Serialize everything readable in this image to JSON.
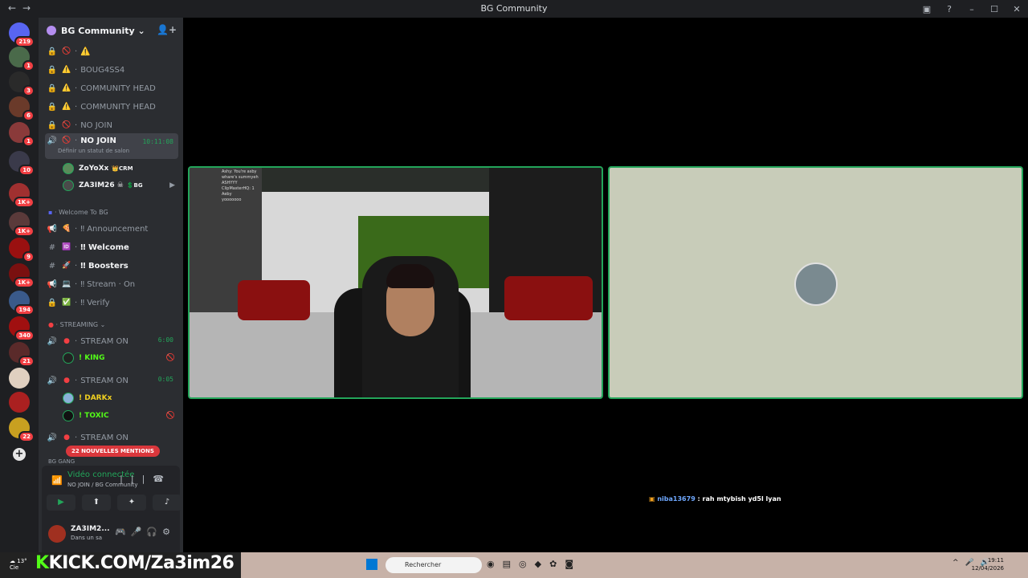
{
  "window": {
    "title": "BG Community"
  },
  "guild": {
    "name": "BG Community"
  },
  "servers": [
    {
      "badge": "219",
      "color": "#5865f2"
    },
    {
      "badge": "1",
      "color": "#4a6a4a"
    },
    {
      "badge": "3",
      "color": "#2a2a2a"
    },
    {
      "badge": "6",
      "color": "#6a3a2a"
    },
    {
      "badge": "1",
      "color": "#8a3a3a"
    },
    {
      "badge": "10",
      "color": "#3a3a4a"
    },
    {
      "badge": "1K+",
      "color": "#a03030"
    },
    {
      "badge": "1K+",
      "color": "#5a3a3a"
    },
    {
      "badge": "9",
      "color": "#9a1010"
    },
    {
      "badge": "1K+",
      "color": "#7a1010"
    },
    {
      "badge": "194",
      "color": "#3a5a8a"
    },
    {
      "badge": "340",
      "color": "#a01010"
    },
    {
      "badge": "21",
      "color": "#5a2a2a"
    },
    {
      "badge": "",
      "color": "#e0d0c0"
    },
    {
      "badge": "",
      "color": "#aa2020"
    },
    {
      "badge": "22",
      "color": "#c8a020"
    }
  ],
  "channels": [
    {
      "icon": "🔒",
      "emoji": "🚫",
      "name": "⚠️"
    },
    {
      "icon": "🔒",
      "emoji": "⚠️",
      "name": "BOUG4SS4"
    },
    {
      "icon": "🔒",
      "emoji": "⚠️",
      "name": "COMMUNITY HEAD"
    },
    {
      "icon": "🔒",
      "emoji": "⚠️",
      "name": "COMMUNITY HEAD"
    },
    {
      "icon": "🔒",
      "emoji": "🚫",
      "name": "NO JOIN"
    }
  ],
  "active_channel": {
    "name": "NO JOIN",
    "time": "10:11:08",
    "status": "Définir un statut de salon"
  },
  "voice_users_1": [
    {
      "name": "ZoYoXx",
      "tag": "👑CRM"
    },
    {
      "name": "ZA3IM26 ☠",
      "tag": "💲BG"
    }
  ],
  "category_welcome": "Welcome To BG",
  "welcome_channels": [
    {
      "icon": "📢",
      "emoji": "🍕",
      "name": "‼ Announcement",
      "bright": false
    },
    {
      "icon": "#",
      "emoji": "🆔",
      "name": "‼ Welcome",
      "bright": true
    },
    {
      "icon": "#",
      "emoji": "🚀",
      "name": "‼ Boosters",
      "bright": true
    },
    {
      "icon": "📢",
      "emoji": "💻",
      "name": "‼ Stream · On",
      "bright": false
    },
    {
      "icon": "🔒",
      "emoji": "✅",
      "name": "‼ Verify",
      "bright": false
    }
  ],
  "category_streaming": "STREAMING",
  "stream_channels": [
    {
      "name": "STREAM ON",
      "time": "6:00"
    },
    {
      "name": "STREAM ON",
      "time": "0:05"
    },
    {
      "name": "STREAM ON",
      "time": ""
    }
  ],
  "stream_users": [
    {
      "name": "! KING"
    },
    {
      "name": "! DARKx"
    },
    {
      "name": "! TOXIC"
    }
  ],
  "category_gang": "BG GANG",
  "mentions_label": "22 NOUVELLES MENTIONS",
  "voice": {
    "connected": "Vidéo connectée",
    "channel": "NO JOIN / BG Community"
  },
  "me": {
    "name": "ZA3IM2...",
    "status": "Dans un sa"
  },
  "overlay_chat": [
    "Ashy: You're asby",
    "whare's summyeh",
    "",
    "",
    "ASHYYY",
    "ClipMasterHQ: 1",
    "Aeby",
    "yooooooo"
  ],
  "chat_message": {
    "user": "niba13679",
    "text": "rah mtybish yd5l lyan"
  },
  "taskbar": {
    "kick_prefix": "K",
    "kick_text": "KICK.COM/Za3im26",
    "weather": "13°",
    "weather_sub": "Cie",
    "search_placeholder": "Rechercher",
    "time": "19:11",
    "date": "12/04/2026"
  }
}
